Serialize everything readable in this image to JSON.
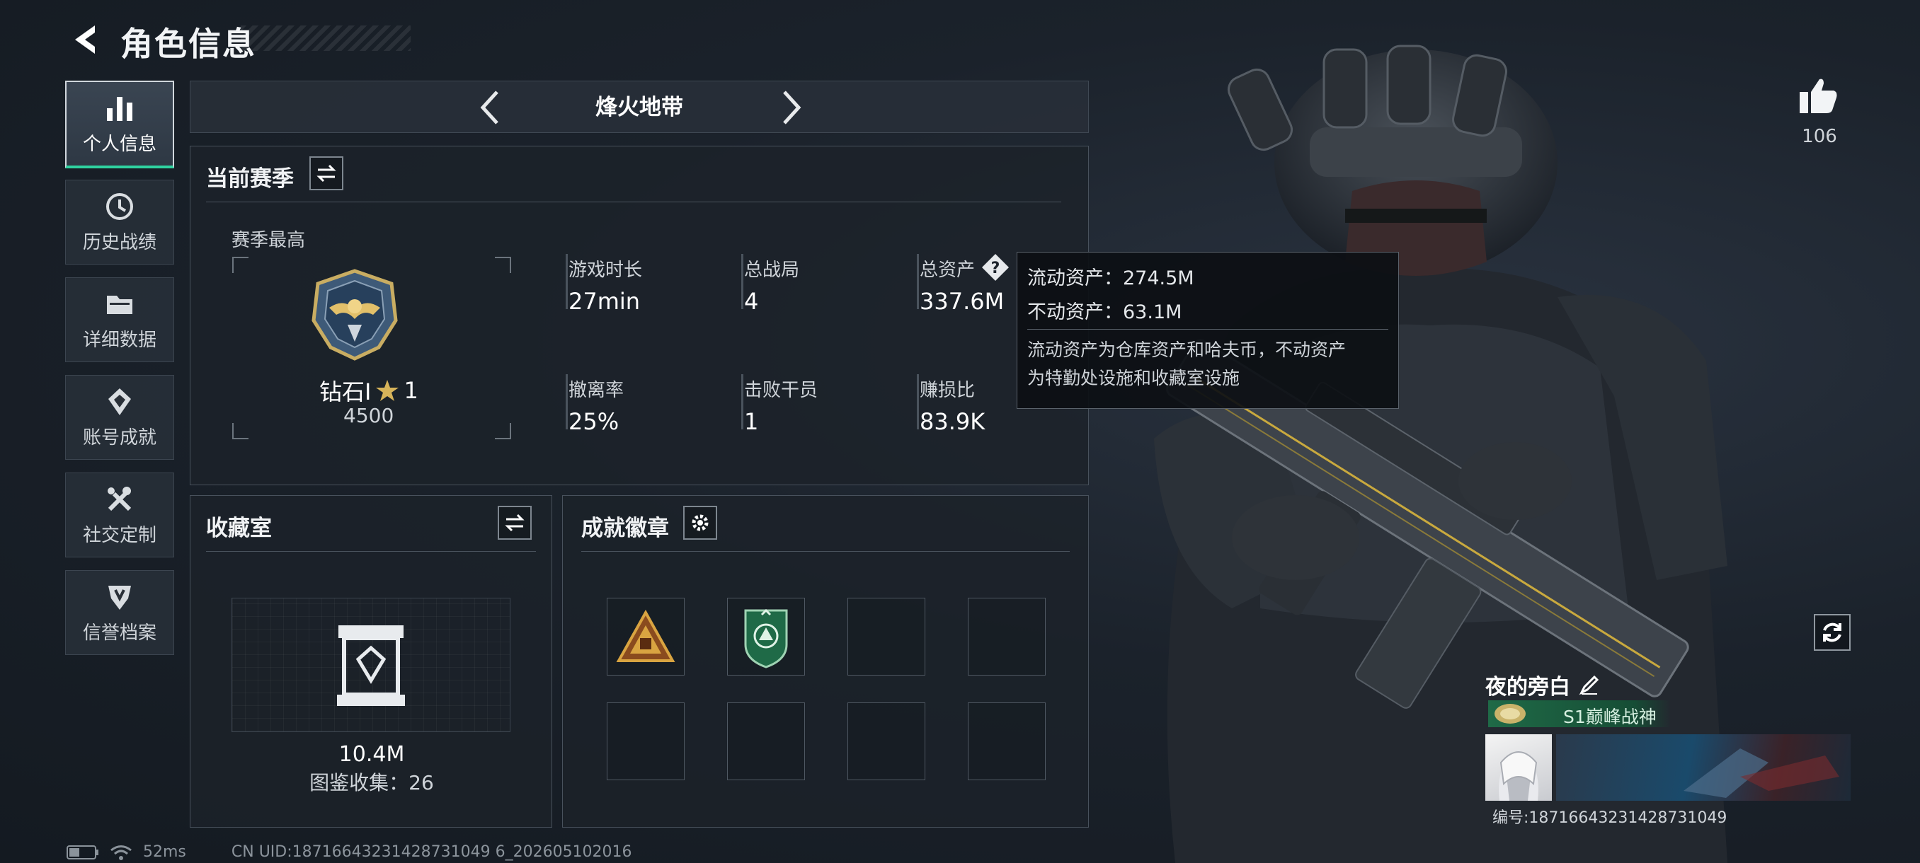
{
  "header": {
    "title": "角色信息"
  },
  "sidebar": {
    "items": [
      {
        "label": "个人信息",
        "icon": "bar-chart-icon",
        "active": true
      },
      {
        "label": "历史战绩",
        "icon": "history-icon",
        "active": false
      },
      {
        "label": "详细数据",
        "icon": "folder-icon",
        "active": false
      },
      {
        "label": "账号成就",
        "icon": "achievement-icon",
        "active": false
      },
      {
        "label": "社交定制",
        "icon": "tools-icon",
        "active": false
      },
      {
        "label": "信誉档案",
        "icon": "shield-icon",
        "active": false
      }
    ]
  },
  "mode_selector": {
    "title": "烽火地带"
  },
  "season": {
    "title": "当前赛季",
    "best_label": "赛季最高",
    "rank_name": "钻石I",
    "rank_stars": "1",
    "rank_score": "4500",
    "stats": [
      {
        "label": "游戏时长",
        "value": "27min"
      },
      {
        "label": "总战局",
        "value": "4"
      },
      {
        "label": "总资产",
        "value": "337.6M"
      },
      {
        "label": "撤离率",
        "value": "25%"
      },
      {
        "label": "击败干员",
        "value": "1"
      },
      {
        "label": "赚损比",
        "value": "83.9K"
      }
    ]
  },
  "tooltip": {
    "liquid": "流动资产：274.5M",
    "fixed": "不动资产：63.1M",
    "desc_line1": "流动资产为仓库资产和哈夫币，不动资产",
    "desc_line2": "为特勤处设施和收藏室设施"
  },
  "collection": {
    "title": "收藏室",
    "value": "10.4M",
    "caption": "图鉴收集：26"
  },
  "badges": {
    "title": "成就徽章"
  },
  "like": {
    "count": "106"
  },
  "player": {
    "name": "夜的旁白",
    "title": "S1巅峰战神",
    "id": "编号:18716643231428731049"
  },
  "status_bar": {
    "ping": "52ms",
    "uid": "CN UID:18716643231428731049 6_202605102016"
  },
  "colors": {
    "accent": "#2fd3a0",
    "gold": "#d7b45a",
    "badge_green": "#1f6a47"
  }
}
